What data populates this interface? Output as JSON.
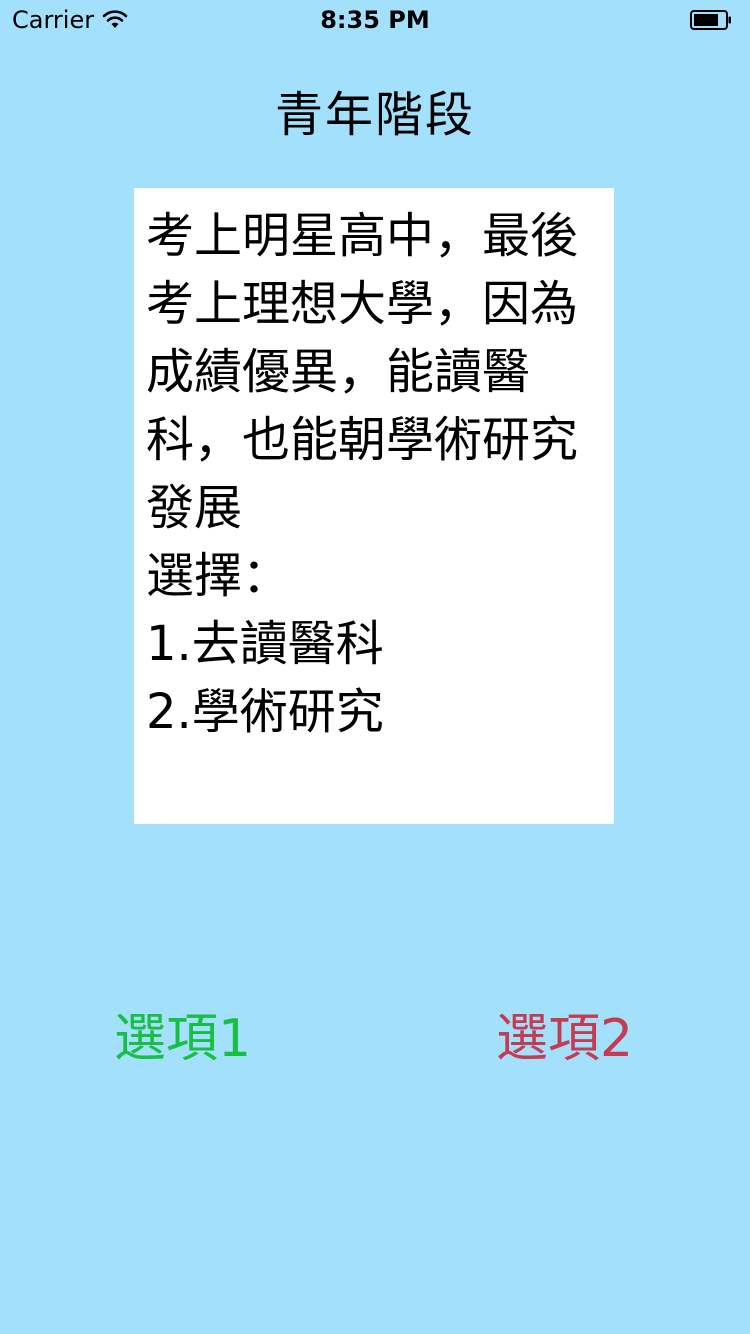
{
  "status_bar": {
    "carrier": "Carrier",
    "time": "8:35 PM",
    "wifi_icon": "wifi-icon",
    "battery_icon": "battery-icon"
  },
  "title": "青年階段",
  "story": {
    "text": "考上明星高中，最後考上理想大學，因為成績優異，能讀醫科，也能朝學術研究發展\n選擇：\n1.去讀醫科\n2.學術研究"
  },
  "options": {
    "option1_label": "選項1",
    "option2_label": "選項2",
    "option1_color": "#19bf43",
    "option2_color": "#c53c52"
  },
  "colors": {
    "background": "#a3e0fb",
    "story_background": "#ffffff"
  }
}
